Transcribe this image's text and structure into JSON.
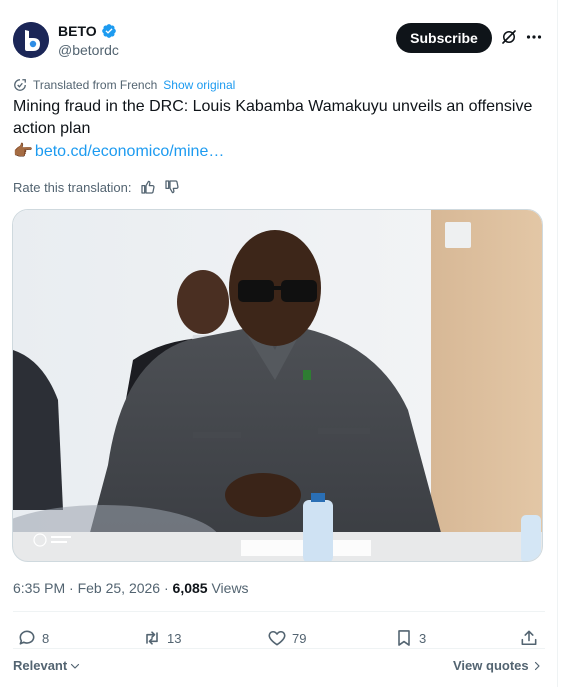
{
  "author": {
    "name": "BETO",
    "handle": "@betordc",
    "verified": true
  },
  "header": {
    "subscribe_label": "Subscribe"
  },
  "translation": {
    "label": "Translated from French",
    "show_original": "Show original"
  },
  "post": {
    "text": "Mining fraud in the DRC: Louis Kabamba Wamakuyu unveils an offensive action plan",
    "link_emoji": "👉🏾",
    "link_text": "beto.cd/economico/mine…"
  },
  "rate": {
    "label": "Rate this translation:"
  },
  "meta": {
    "time": "6:35 PM · Feb 25, 2026 · ",
    "views_count": "6,085",
    "views_label": " Views"
  },
  "actions": {
    "replies": "8",
    "reposts": "13",
    "likes": "79",
    "bookmarks": "3"
  },
  "footer": {
    "sort_label": "Relevant",
    "view_quotes": "View quotes"
  },
  "colors": {
    "accent": "#1d9bf0",
    "text_primary": "#0f1419",
    "text_secondary": "#536471",
    "subscribe_bg": "#0f1419"
  }
}
